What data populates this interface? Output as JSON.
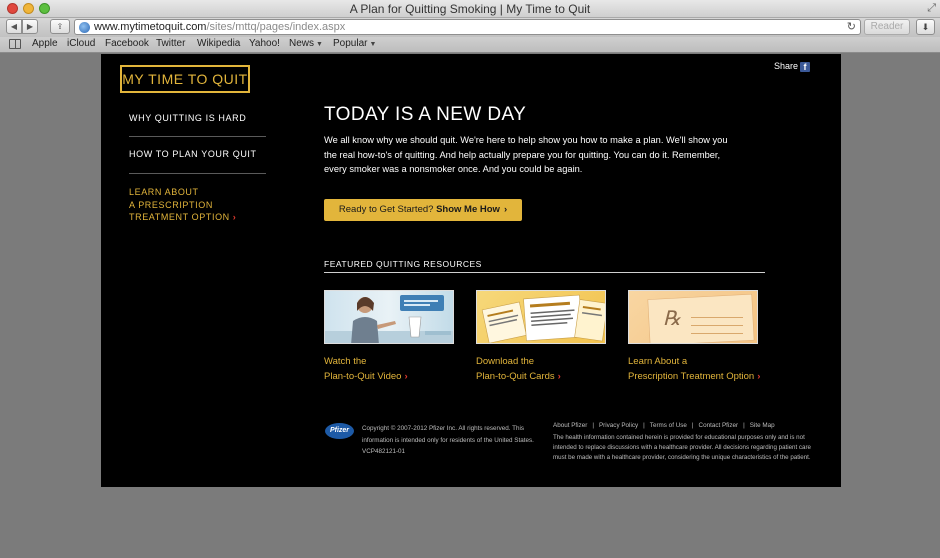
{
  "browser": {
    "window_title": "A Plan for Quitting Smoking | My Time to Quit",
    "url_host": "www.mytimetoquit.com",
    "url_path": "/sites/mttq/pages/index.aspx",
    "reader_label": "Reader",
    "bookmarks": [
      "Apple",
      "iCloud",
      "Facebook",
      "Twitter",
      "Wikipedia",
      "Yahoo!",
      "News",
      "Popular"
    ]
  },
  "site": {
    "logo": "MY TIME TO QUIT",
    "share_label": "Share",
    "nav": {
      "item1": "WHY QUITTING IS HARD",
      "item2": "HOW TO PLAN YOUR QUIT",
      "item3_line1": "LEARN ABOUT",
      "item3_line2": "A PRESCRIPTION",
      "item3_line3": "TREATMENT OPTION"
    },
    "headline": "TODAY IS A NEW DAY",
    "intro": "We all know why we should quit. We're here to help show you how to make a plan. We'll show you the real how-to's of quitting. And help actually prepare you for quitting. You can do it. Remember, every smoker was a nonsmoker once. And you could be again.",
    "cta_prefix": "Ready to Get Started?",
    "cta_bold": "Show Me How",
    "featured_heading": "FEATURED QUITTING RESOURCES",
    "resources": [
      {
        "line1": "Watch the",
        "line2": "Plan-to-Quit Video"
      },
      {
        "line1": "Download the",
        "line2": "Plan-to-Quit Cards"
      },
      {
        "line1": "Learn About a",
        "line2": "Prescription Treatment Option"
      }
    ],
    "footer": {
      "pfizer_logo": "Pfizer",
      "copyright": "Copyright © 2007-2012 Pfizer Inc. All rights reserved. This information is intended only for residents of the United States. VCP482121-01",
      "links": [
        "About Pfizer",
        "Privacy Policy",
        "Terms of Use",
        "Contact Pfizer",
        "Site Map"
      ],
      "disclaimer": "The health information contained herein is provided for educational purposes only and is not intended to replace discussions with a healthcare provider. All decisions regarding patient care must be made with a healthcare provider, considering the unique characteristics of the patient."
    }
  },
  "colors": {
    "accent": "#e2b53b",
    "chevron": "#e03a2f",
    "background": "#000000"
  }
}
